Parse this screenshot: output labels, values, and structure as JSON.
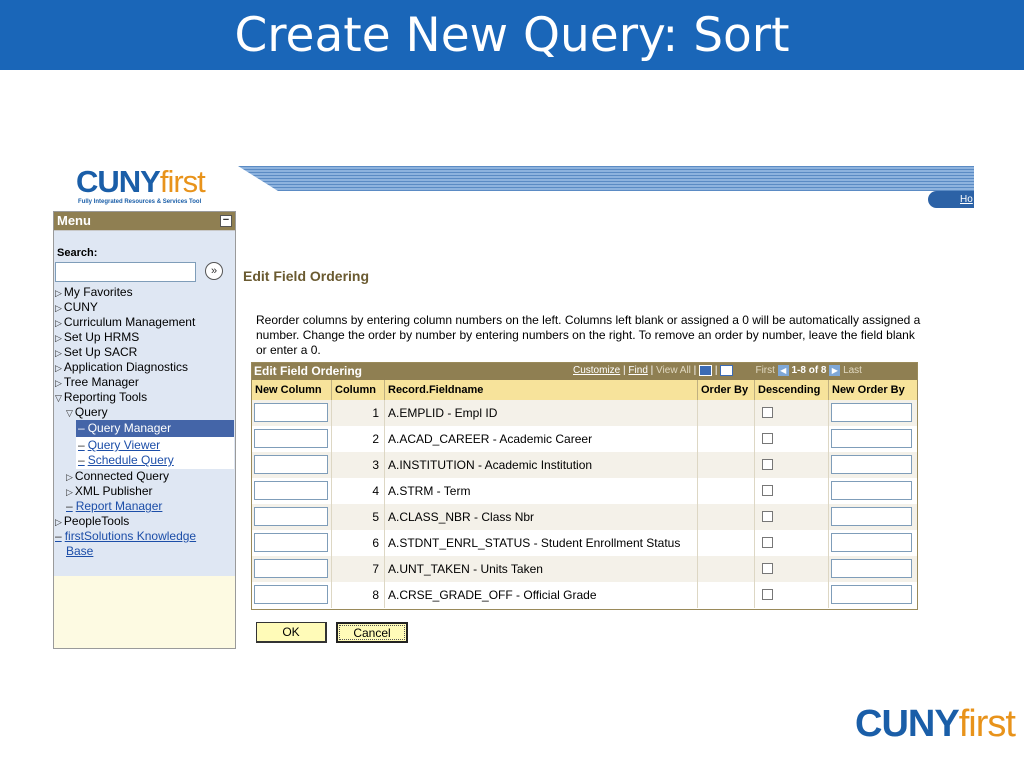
{
  "slide_title": "Create New Query: Sort",
  "logo": {
    "cuny": "CUNY",
    "first": "first",
    "tagline": "Fully Integrated Resources & Services Tool"
  },
  "header": {
    "home_link": "Ho"
  },
  "menu": {
    "title": "Menu",
    "collapse_symbol": "−",
    "search_label": "Search:",
    "search_value": "",
    "search_go_symbol": "»",
    "items": [
      {
        "label": "My Favorites",
        "type": "folder"
      },
      {
        "label": "CUNY",
        "type": "folder"
      },
      {
        "label": "Curriculum Management",
        "type": "folder"
      },
      {
        "label": "Set Up HRMS",
        "type": "folder"
      },
      {
        "label": "Set Up SACR",
        "type": "folder"
      },
      {
        "label": "Application Diagnostics",
        "type": "folder"
      },
      {
        "label": "Tree Manager",
        "type": "folder"
      },
      {
        "label": "Reporting Tools",
        "type": "folder-open"
      },
      {
        "label": "Query",
        "type": "folder-open"
      },
      {
        "label": "Query Manager",
        "type": "selected"
      },
      {
        "label": "Query Viewer",
        "type": "link"
      },
      {
        "label": "Schedule Query",
        "type": "link"
      },
      {
        "label": "Connected Query",
        "type": "folder"
      },
      {
        "label": "XML Publisher",
        "type": "folder"
      },
      {
        "label": "Report Manager",
        "type": "link"
      },
      {
        "label": "PeopleTools",
        "type": "folder"
      },
      {
        "label": "firstSolutions Knowledge",
        "type": "link"
      },
      {
        "label": "Base",
        "type": "link"
      }
    ]
  },
  "page": {
    "section_title": "Edit Field Ordering",
    "instructions": "Reorder columns by entering column numbers on the left. Columns left blank or assigned a 0 will be automatically assigned a number. Change the order by number by entering numbers on the right. To remove an order by number, leave the field blank or enter a 0."
  },
  "grid": {
    "title": "Edit Field Ordering",
    "customize": "Customize",
    "find": "Find",
    "view_all": "View All",
    "separator": "|",
    "first": "First",
    "range": "1-8 of 8",
    "last": "Last",
    "columns": [
      "New Column",
      "Column",
      "Record.Fieldname",
      "Order By",
      "Descending",
      "New Order By"
    ],
    "rows": [
      {
        "new_column": "",
        "column": "1",
        "fieldname": "A.EMPLID - Empl ID",
        "order_by": "",
        "descending": false,
        "new_order_by": ""
      },
      {
        "new_column": "",
        "column": "2",
        "fieldname": "A.ACAD_CAREER - Academic Career",
        "order_by": "",
        "descending": false,
        "new_order_by": ""
      },
      {
        "new_column": "",
        "column": "3",
        "fieldname": "A.INSTITUTION - Academic Institution",
        "order_by": "",
        "descending": false,
        "new_order_by": ""
      },
      {
        "new_column": "",
        "column": "4",
        "fieldname": "A.STRM - Term",
        "order_by": "",
        "descending": false,
        "new_order_by": ""
      },
      {
        "new_column": "",
        "column": "5",
        "fieldname": "A.CLASS_NBR - Class Nbr",
        "order_by": "",
        "descending": false,
        "new_order_by": ""
      },
      {
        "new_column": "",
        "column": "6",
        "fieldname": "A.STDNT_ENRL_STATUS - Student Enrollment Status",
        "order_by": "",
        "descending": false,
        "new_order_by": ""
      },
      {
        "new_column": "",
        "column": "7",
        "fieldname": "A.UNT_TAKEN - Units Taken",
        "order_by": "",
        "descending": false,
        "new_order_by": ""
      },
      {
        "new_column": "",
        "column": "8",
        "fieldname": "A.CRSE_GRADE_OFF - Official Grade",
        "order_by": "",
        "descending": false,
        "new_order_by": ""
      }
    ]
  },
  "buttons": {
    "ok": "OK",
    "cancel": "Cancel"
  },
  "footer_logo": {
    "cuny": "CUNY",
    "first": "first"
  },
  "colors": {
    "title_bar": "#1a66b8",
    "grid_header": "#8f7f52",
    "column_header": "#f7e39b",
    "menu_selected": "#4465a8",
    "brand_blue": "#1a5ea8",
    "brand_orange": "#e8931b"
  }
}
